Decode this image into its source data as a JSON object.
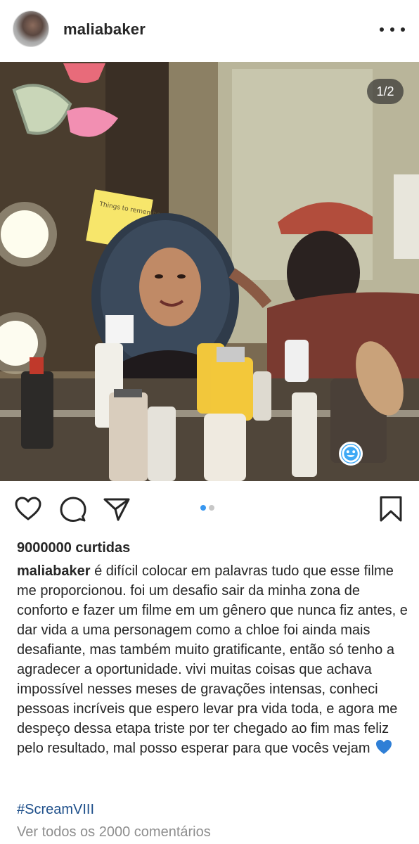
{
  "header": {
    "username": "maliabaker",
    "more_icon": "more-horizontal-icon"
  },
  "photo": {
    "counter": "1/2",
    "tag_icon": "user-tag-icon",
    "sticky_note_text": "Things to remember"
  },
  "actions": {
    "like_icon": "heart-outline-icon",
    "comment_icon": "comment-icon",
    "share_icon": "send-icon",
    "save_icon": "bookmark-icon",
    "carousel_active_color": "#3897f0",
    "carousel_inactive_color": "#c7c7c7",
    "carousel_count": 2,
    "carousel_active_index": 0
  },
  "post": {
    "likes": "9000000 curtidas",
    "caption_user": "maliabaker",
    "caption_text": "é difícil colocar em palavras tudo que esse filme me proporcionou. foi um desafio sair da minha zona de conforto e fazer um filme em um gênero que nunca fiz antes, e dar vida a uma personagem como a chloe foi ainda mais desafiante, mas também muito gratificante, então só tenho a agradecer a oportunidade. vivi muitas coisas que achava impossível nesses meses de gravações intensas, conheci pessoas incríveis que espero levar pra vida toda, e agora me despeço dessa etapa triste por ter chegado ao fim mas feliz pelo resultado, mal posso esperar para que vocês vejam",
    "caption_emoji": "blue-heart-icon",
    "hashtag": "#ScreamVIII",
    "view_comments": "Ver todos os 2000 comentários"
  }
}
